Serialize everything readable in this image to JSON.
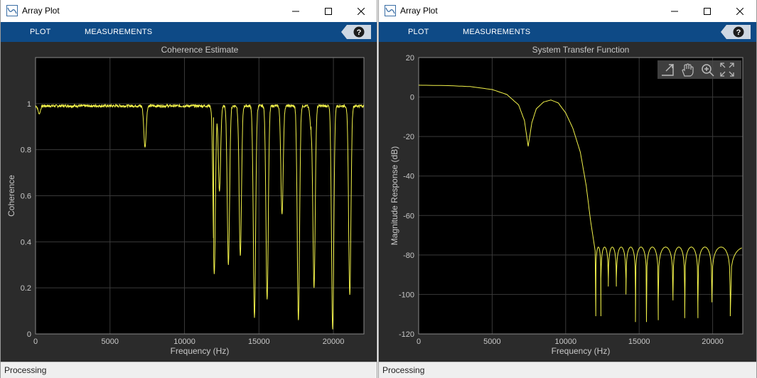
{
  "windows": [
    {
      "id": "left",
      "title": "Array Plot",
      "tabs": [
        "PLOT",
        "MEASUREMENTS"
      ],
      "help_label": "?",
      "status": "Processing",
      "chart": {
        "type": "line",
        "title": "Coherence Estimate",
        "xlabel": "Frequency (Hz)",
        "ylabel": "Coherence",
        "xlim": [
          0,
          22050
        ],
        "ylim": [
          0,
          1.2
        ],
        "xticks": [
          0,
          5000,
          10000,
          15000,
          20000
        ],
        "xtick_labels": [
          "0",
          "5000",
          "10000",
          "15000",
          "20000"
        ],
        "yticks": [
          0,
          0.2,
          0.4,
          0.6,
          0.8,
          1
        ],
        "ytick_labels": [
          "0",
          "0.2",
          "0.4",
          "0.6",
          "0.8",
          "1"
        ],
        "grid": true,
        "line_color": "#f2f24a",
        "baseline": 0.99,
        "dips": [
          {
            "x": 250,
            "y": 0.955
          },
          {
            "x": 7350,
            "y": 0.81
          },
          {
            "x": 11950,
            "y": 0.94
          },
          {
            "x": 12000,
            "y": 0.26
          },
          {
            "x": 12350,
            "y": 0.62
          },
          {
            "x": 12950,
            "y": 0.3
          },
          {
            "x": 13750,
            "y": 0.34
          },
          {
            "x": 14700,
            "y": 0.07
          },
          {
            "x": 15550,
            "y": 0.15
          },
          {
            "x": 16550,
            "y": 0.52
          },
          {
            "x": 17650,
            "y": 0.06
          },
          {
            "x": 18500,
            "y": 0.9
          },
          {
            "x": 18700,
            "y": 0.2
          },
          {
            "x": 19950,
            "y": 0.02
          },
          {
            "x": 21100,
            "y": 0.17
          }
        ]
      }
    },
    {
      "id": "right",
      "title": "Array Plot",
      "tabs": [
        "PLOT",
        "MEASUREMENTS"
      ],
      "help_label": "?",
      "status": "Processing",
      "chart": {
        "type": "line",
        "title": "System Transfer Function",
        "xlabel": "Frequency (Hz)",
        "ylabel": "Magnitude Response (dB)",
        "xlim": [
          0,
          22050
        ],
        "ylim": [
          -120,
          20
        ],
        "xticks": [
          0,
          5000,
          10000,
          15000,
          20000
        ],
        "xtick_labels": [
          "0",
          "5000",
          "10000",
          "15000",
          "20000"
        ],
        "yticks": [
          -120,
          -100,
          -80,
          -60,
          -40,
          -20,
          0,
          20
        ],
        "ytick_labels": [
          "-120",
          "-100",
          "-80",
          "-60",
          "-40",
          "-20",
          "0",
          "20"
        ],
        "grid": true,
        "line_color": "#f2f24a",
        "tools": [
          "pan-icon",
          "hand-icon",
          "zoom-in-icon",
          "fit-icon"
        ],
        "curve_points": [
          [
            0,
            6
          ],
          [
            2000,
            5.8
          ],
          [
            3500,
            5.3
          ],
          [
            5000,
            3.8
          ],
          [
            6000,
            1.3
          ],
          [
            6800,
            -4
          ],
          [
            7200,
            -12
          ],
          [
            7450,
            -25
          ],
          [
            7700,
            -13
          ],
          [
            8000,
            -6
          ],
          [
            8500,
            -2.5
          ],
          [
            9000,
            -1.5
          ],
          [
            9500,
            -3
          ],
          [
            10000,
            -8
          ],
          [
            10500,
            -16
          ],
          [
            11000,
            -28
          ],
          [
            11400,
            -45
          ],
          [
            11700,
            -63
          ],
          [
            12050,
            -80
          ]
        ],
        "sidelobe_nulls": [
          12050,
          12400,
          12900,
          13450,
          14100,
          14750,
          15500,
          16300,
          17300,
          18100,
          19000,
          19950,
          21200
        ],
        "null_depths": [
          -111,
          -92,
          -96,
          -92,
          -100,
          -114,
          -113,
          -103,
          -100,
          -112,
          -104,
          -102,
          -111
        ],
        "sidelobe_peak": -76
      }
    }
  ]
}
